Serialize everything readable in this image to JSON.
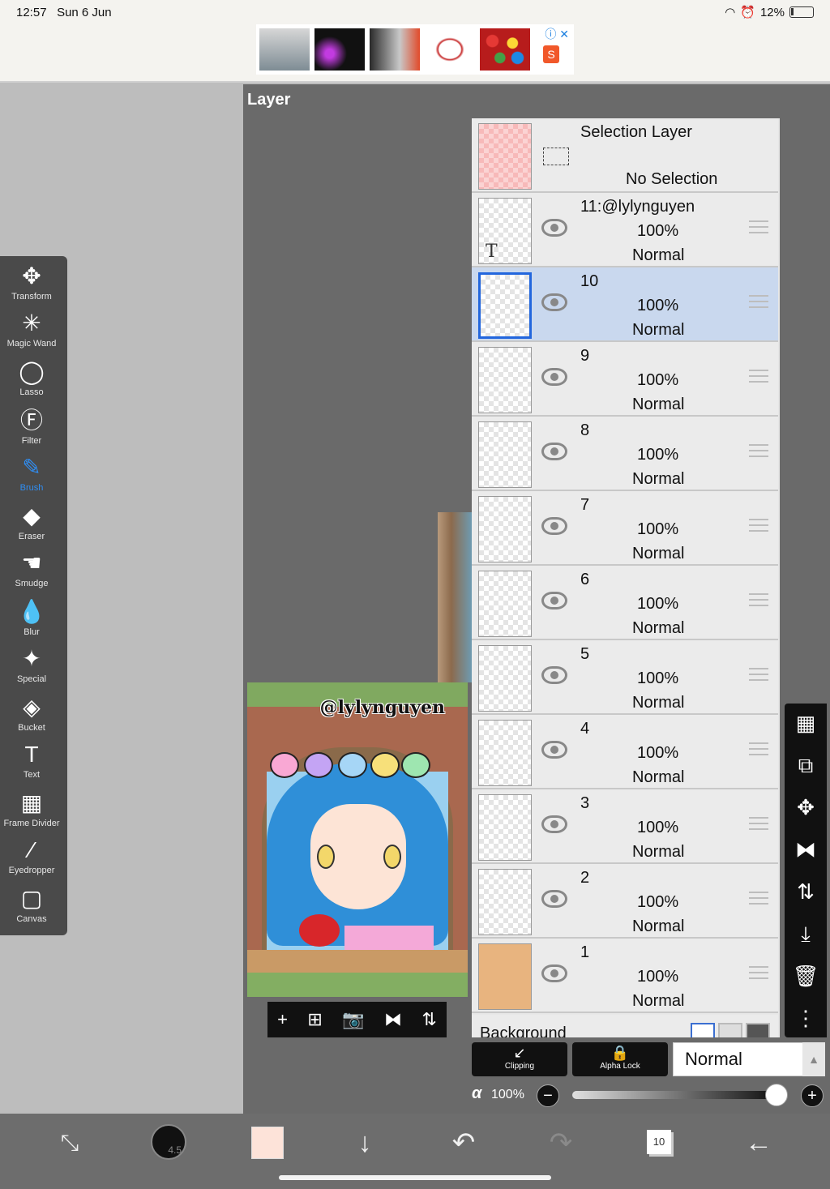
{
  "status_bar": {
    "time": "12:57",
    "date": "Sun 6 Jun",
    "battery": "12%"
  },
  "ad": {
    "info_icon": "info-icon",
    "close_icon": "close-icon",
    "bag_icon": "shopping-bag-icon",
    "bag_label": "S"
  },
  "tools": [
    {
      "id": "transform",
      "label": "Transform",
      "icon": "✥"
    },
    {
      "id": "magic-wand",
      "label": "Magic Wand",
      "icon": "✳"
    },
    {
      "id": "lasso",
      "label": "Lasso",
      "icon": "◯"
    },
    {
      "id": "filter",
      "label": "Filter",
      "icon": "Ⓕ"
    },
    {
      "id": "brush",
      "label": "Brush",
      "icon": "✎",
      "active": true
    },
    {
      "id": "eraser",
      "label": "Eraser",
      "icon": "◆"
    },
    {
      "id": "smudge",
      "label": "Smudge",
      "icon": "☚"
    },
    {
      "id": "blur",
      "label": "Blur",
      "icon": "💧"
    },
    {
      "id": "special",
      "label": "Special",
      "icon": "✦"
    },
    {
      "id": "bucket",
      "label": "Bucket",
      "icon": "◈"
    },
    {
      "id": "text",
      "label": "Text",
      "icon": "T"
    },
    {
      "id": "frame-divider",
      "label": "Frame Divider",
      "icon": "▦"
    },
    {
      "id": "eyedropper",
      "label": "Eyedropper",
      "icon": "⁄"
    },
    {
      "id": "canvas",
      "label": "Canvas",
      "icon": "▢"
    }
  ],
  "layer_panel": {
    "title": "Layer",
    "selection_layer": {
      "name": "Selection Layer",
      "status": "No Selection"
    },
    "layers": [
      {
        "name": "11:@lylynguyen",
        "opacity": "100%",
        "mode": "Normal",
        "thumb": "text"
      },
      {
        "name": "10",
        "opacity": "100%",
        "mode": "Normal",
        "selected": true
      },
      {
        "name": "9",
        "opacity": "100%",
        "mode": "Normal"
      },
      {
        "name": "8",
        "opacity": "100%",
        "mode": "Normal"
      },
      {
        "name": "7",
        "opacity": "100%",
        "mode": "Normal"
      },
      {
        "name": "6",
        "opacity": "100%",
        "mode": "Normal"
      },
      {
        "name": "5",
        "opacity": "100%",
        "mode": "Normal"
      },
      {
        "name": "4",
        "opacity": "100%",
        "mode": "Normal"
      },
      {
        "name": "3",
        "opacity": "100%",
        "mode": "Normal"
      },
      {
        "name": "2",
        "opacity": "100%",
        "mode": "Normal"
      },
      {
        "name": "1",
        "opacity": "100%",
        "mode": "Normal",
        "thumb": "tan"
      }
    ],
    "background_label": "Background",
    "text_thumb_mark": "T"
  },
  "canvas": {
    "watermark": "@lylynguyen"
  },
  "canvas_toolbar": [
    "+",
    "⊞",
    "📷",
    "⧓",
    "⇅"
  ],
  "right_toolbar": [
    {
      "id": "checker",
      "icon": "▦"
    },
    {
      "id": "copy-layer",
      "icon": "⧉"
    },
    {
      "id": "move",
      "icon": "✥"
    },
    {
      "id": "flip-horizontal",
      "icon": "⧓"
    },
    {
      "id": "flip-vertical",
      "icon": "⇅"
    },
    {
      "id": "merge-down",
      "icon": "⤓"
    },
    {
      "id": "delete",
      "icon": "🗑"
    },
    {
      "id": "more",
      "icon": "⋮"
    }
  ],
  "blend": {
    "clipping_label": "Clipping",
    "alpha_lock_label": "Alpha Lock",
    "mode": "Normal"
  },
  "opacity": {
    "symbol": "α",
    "value": "100%",
    "level": 1.0
  },
  "bottom_bar": {
    "brush_size": "4.5",
    "layer_count": "10",
    "accent": "#2f8ef4"
  }
}
